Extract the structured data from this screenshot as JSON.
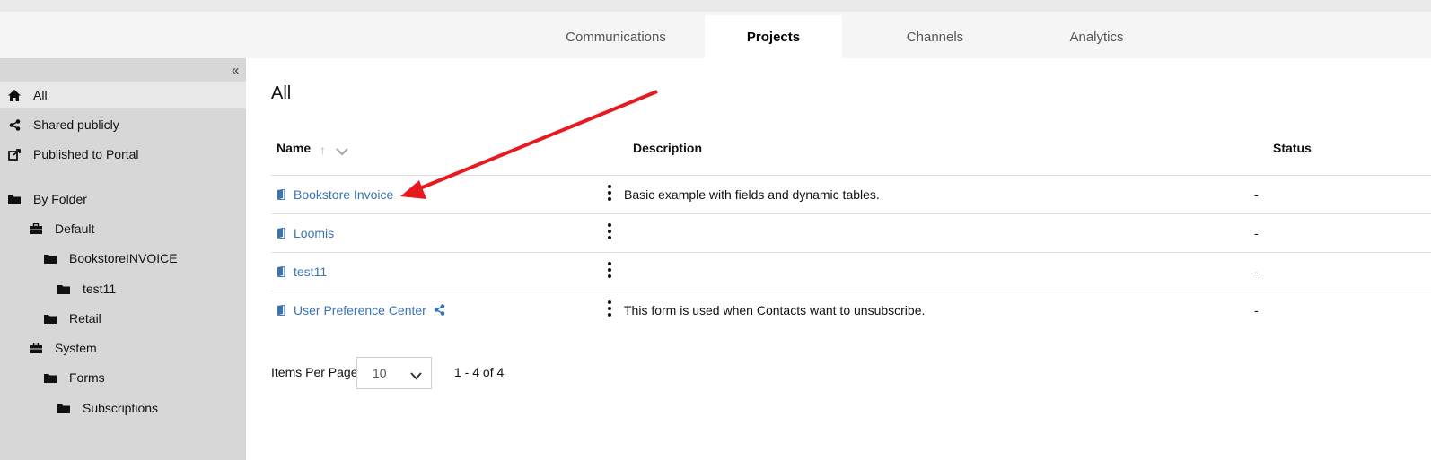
{
  "tabs": [
    {
      "label": "Communications",
      "active": false
    },
    {
      "label": "Projects",
      "active": true
    },
    {
      "label": "Channels",
      "active": false
    },
    {
      "label": "Analytics",
      "active": false
    }
  ],
  "sidebar": {
    "collapse_icon": "double-chevron-left-icon",
    "items": [
      {
        "label": "All",
        "icon": "home-icon",
        "active": true
      },
      {
        "label": "Shared publicly",
        "icon": "share-icon"
      },
      {
        "label": "Published to Portal",
        "icon": "external-link-icon"
      },
      {
        "label": "By Folder",
        "icon": "folder-icon"
      },
      {
        "label": "Default",
        "icon": "briefcase-icon"
      },
      {
        "label": "BookstoreINVOICE",
        "icon": "folder-icon"
      },
      {
        "label": "test11",
        "icon": "folder-icon"
      },
      {
        "label": "Retail",
        "icon": "folder-icon"
      },
      {
        "label": "System",
        "icon": "briefcase-icon"
      },
      {
        "label": "Forms",
        "icon": "folder-icon"
      },
      {
        "label": "Subscriptions",
        "icon": "folder-icon"
      }
    ]
  },
  "main": {
    "title": "All",
    "columns": {
      "name": "Name",
      "description": "Description",
      "status": "Status"
    },
    "rows": [
      {
        "name": "Bookstore Invoice",
        "description": "Basic example with fields and dynamic tables.",
        "status": "-",
        "shared": false
      },
      {
        "name": "Loomis",
        "description": "",
        "status": "-",
        "shared": false
      },
      {
        "name": "test11",
        "description": "",
        "status": "-",
        "shared": false
      },
      {
        "name": "User Preference Center",
        "description": "This form is used when Contacts want to unsubscribe.",
        "status": "-",
        "shared": true
      }
    ],
    "pagination": {
      "items_per_page_label": "Items Per Page",
      "items_per_page_value": "10",
      "range_text": "1 - 4 of 4"
    }
  },
  "colors": {
    "link": "#3a73b3",
    "annotation_arrow": "#e8191f",
    "sidebar_bg": "#d7d7d7"
  }
}
